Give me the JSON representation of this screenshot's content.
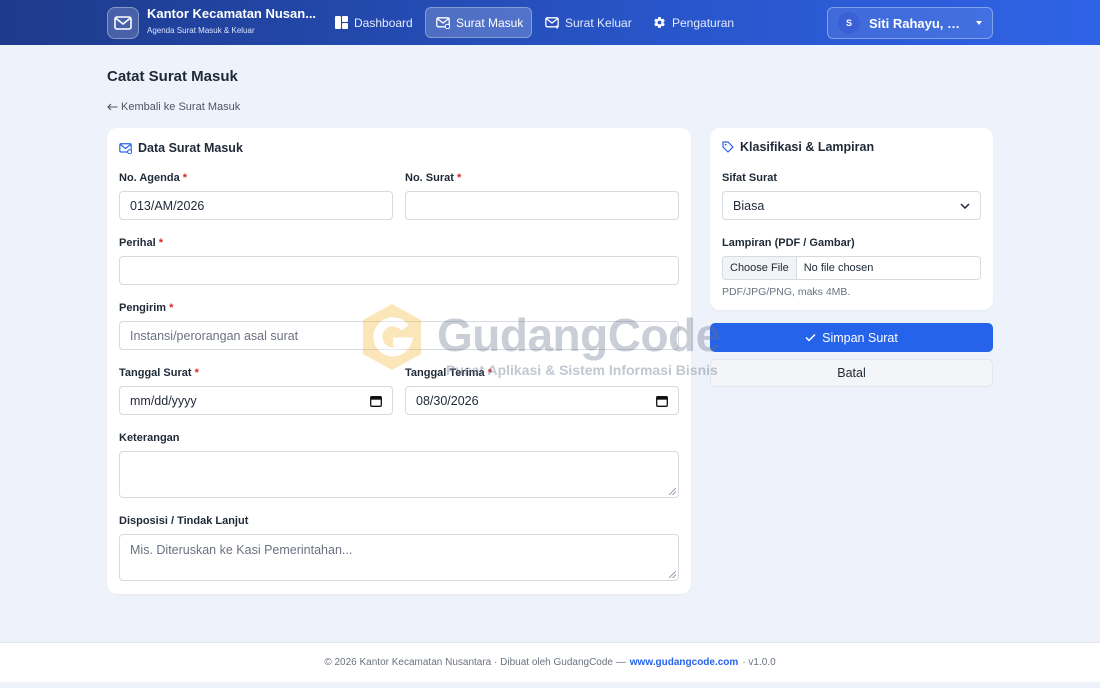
{
  "navbar": {
    "brand_title": "Kantor Kecamatan Nusan...",
    "brand_subtitle": "Agenda Surat Masuk & Keluar",
    "items": [
      {
        "label": "Dashboard",
        "icon": "dashboard-icon",
        "active": false
      },
      {
        "label": "Surat Masuk",
        "icon": "mail-in-icon",
        "active": true
      },
      {
        "label": "Surat Keluar",
        "icon": "mail-out-icon",
        "active": false
      },
      {
        "label": "Pengaturan",
        "icon": "gear-icon",
        "active": false
      }
    ],
    "user": {
      "initial": "S",
      "name": "Siti Rahayu, S.A..."
    }
  },
  "page": {
    "title": "Catat Surat Masuk",
    "back_link": "Kembali ke Surat Masuk"
  },
  "form": {
    "heading": "Data Surat Masuk",
    "no_agenda": {
      "label": "No. Agenda",
      "value": "013/AM/2026"
    },
    "no_surat": {
      "label": "No. Surat",
      "value": ""
    },
    "perihal": {
      "label": "Perihal",
      "value": ""
    },
    "pengirim": {
      "label": "Pengirim",
      "placeholder": "Instansi/perorangan asal surat"
    },
    "tanggal_surat": {
      "label": "Tanggal Surat",
      "value": "mm/dd/yyyy"
    },
    "tanggal_terima": {
      "label": "Tanggal Terima",
      "value": "08/30/2026"
    },
    "keterangan": {
      "label": "Keterangan",
      "value": ""
    },
    "disposisi": {
      "label": "Disposisi / Tindak Lanjut",
      "placeholder": "Mis. Diteruskan ke Kasi Pemerintahan..."
    },
    "required_mark": "*"
  },
  "side": {
    "heading": "Klasifikasi & Lampiran",
    "sifat_surat": {
      "label": "Sifat Surat",
      "value": "Biasa"
    },
    "lampiran": {
      "label": "Lampiran (PDF / Gambar)",
      "button": "Choose File",
      "file_status": "No file chosen",
      "help": "PDF/JPG/PNG, maks 4MB."
    }
  },
  "actions": {
    "save": "Simpan Surat",
    "cancel": "Batal"
  },
  "watermark": {
    "title": "GudangCode",
    "subtitle": "Pusat Aplikasi & Sistem Informasi Bisnis"
  },
  "footer": {
    "text_before": "© 2026 Kantor Kecamatan Nusantara · Dibuat oleh GudangCode —",
    "link": "www.gudangcode.com",
    "text_after": "· v1.0.0"
  },
  "colors": {
    "primary": "#2563eb",
    "navbar_start": "#1e3a8a",
    "navbar_end": "#2f63e6",
    "required": "#dc2626",
    "page_bg": "#eef2fa"
  }
}
